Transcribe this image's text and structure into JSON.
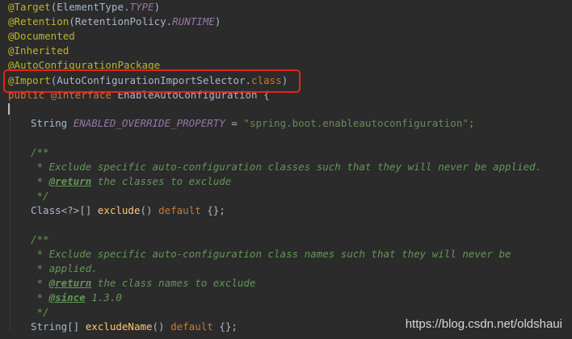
{
  "code": {
    "l1_ann": "@Target",
    "l1_open": "(ElementType.",
    "l1_const": "TYPE",
    "l1_close": ")",
    "l2_ann": "@Retention",
    "l2_open": "(RetentionPolicy.",
    "l2_const": "RUNTIME",
    "l2_close": ")",
    "l3_ann": "@Documented",
    "l4_ann": "@Inherited",
    "l5_ann": "@AutoConfigurationPackage",
    "l6_ann": "@Import",
    "l6_open": "(AutoConfigurationImportSelector.",
    "l6_kw": "class",
    "l6_close": ")",
    "l7_kw": "public",
    "l7_ann": "@interface",
    "l7_name": " EnableAutoConfiguration {",
    "l8_type": "String ",
    "l8_const": "ENABLED_OVERRIDE_PROPERTY",
    "l8_eq": " = ",
    "l8_str": "\"spring.boot.enableautoconfiguration\"",
    "l8_semi": ";",
    "d1_open": "/**",
    "d1_l1": " * Exclude specific auto-configuration classes such that they will never be applied.",
    "d1_l2_star": " * ",
    "d1_l2_tag": "@return",
    "d1_l2_text": " the classes to exclude",
    "d1_close": " */",
    "m1_type": "Class<?>[] ",
    "m1_name": "exclude",
    "m1_paren": "() ",
    "m1_kw": "default",
    "m1_rest": " {};",
    "d2_open": "/**",
    "d2_l1": " * Exclude specific auto-configuration class names such that they will never be",
    "d2_l2": " * applied.",
    "d2_l3_star": " * ",
    "d2_l3_tag": "@return",
    "d2_l3_text": " the class names to exclude",
    "d2_l4_star": " * ",
    "d2_l4_tag": "@since",
    "d2_l4_text": " 1.3.0",
    "d2_close": " */",
    "m2_type": "String[] ",
    "m2_name": "excludeName",
    "m2_paren": "() ",
    "m2_kw": "default",
    "m2_rest": " {};"
  },
  "watermark": "https://blog.csdn.net/oldshaui",
  "colors": {
    "background": "#2b2b2b",
    "annotation": "#bbb529",
    "keyword": "#cc7832",
    "constant": "#9876aa",
    "string": "#6a8759",
    "doc_comment": "#629755",
    "highlight_border": "#e5251a"
  }
}
